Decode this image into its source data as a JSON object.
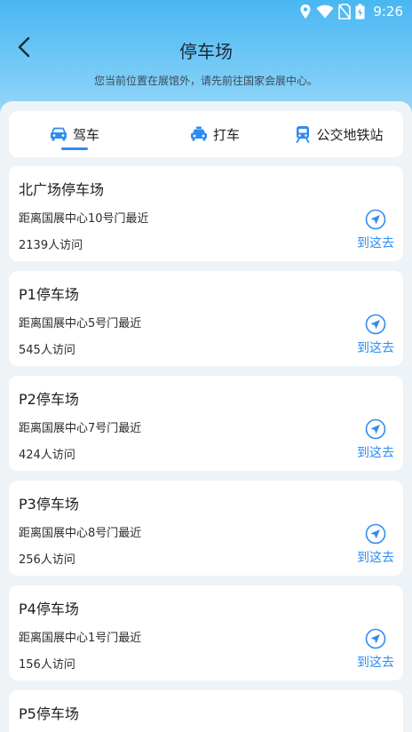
{
  "status_bar": {
    "time": "9:26"
  },
  "header": {
    "title": "停车场",
    "location_hint": "您当前位置在展馆外，请先前往国家会展中心。"
  },
  "tabs": [
    {
      "label": "驾车",
      "icon": "car-icon",
      "active": true
    },
    {
      "label": "打车",
      "icon": "taxi-icon",
      "active": false
    },
    {
      "label": "公交地铁站",
      "icon": "train-icon",
      "active": false
    }
  ],
  "colors": {
    "accent": "#2f8cf0",
    "header_gradient_top": "#49b7f2",
    "background": "#eef3f7"
  },
  "parking_lots": [
    {
      "name": "北广场停车场",
      "desc": "距离国展中心10号门最近",
      "visits": "2139人访问",
      "action": "到这去"
    },
    {
      "name": "P1停车场",
      "desc": "距离国展中心5号门最近",
      "visits": "545人访问",
      "action": "到这去"
    },
    {
      "name": "P2停车场",
      "desc": "距离国展中心7号门最近",
      "visits": "424人访问",
      "action": "到这去"
    },
    {
      "name": "P3停车场",
      "desc": "距离国展中心8号门最近",
      "visits": "256人访问",
      "action": "到这去"
    },
    {
      "name": "P4停车场",
      "desc": "距离国展中心1号门最近",
      "visits": "156人访问",
      "action": "到这去"
    },
    {
      "name": "P5停车场",
      "desc": "",
      "visits": "",
      "action": ""
    }
  ]
}
